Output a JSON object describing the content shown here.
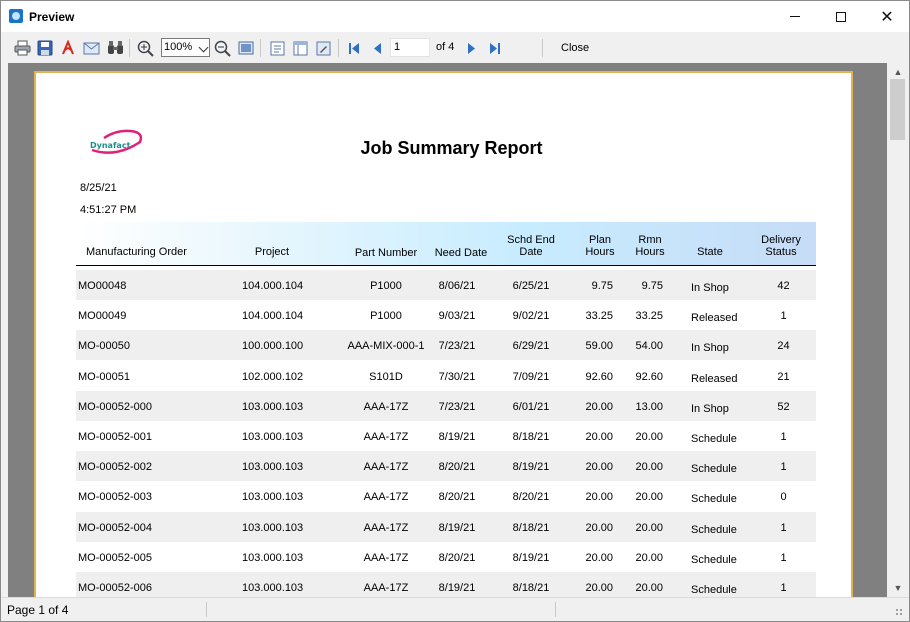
{
  "window": {
    "title": "Preview"
  },
  "toolbar": {
    "zoom": "100%",
    "page_number": "1",
    "page_of": "of 4",
    "close_label": "Close",
    "icons": [
      "print-icon",
      "save-icon",
      "pdf-icon",
      "email-icon",
      "find-icon",
      "zoom-in-icon",
      "zoom-out-icon",
      "fit-page-icon",
      "single-page-icon",
      "two-page-icon",
      "page-setup-icon",
      "first-page-icon",
      "previous-page-icon",
      "next-page-icon",
      "last-page-icon"
    ]
  },
  "report": {
    "logo_text": "Dynafact",
    "title": "Job Summary Report",
    "date": "8/25/21",
    "time": "4:51:27 PM",
    "columns": {
      "mo": "Manufacturing Order",
      "project": "Project",
      "part": "Part Number",
      "need": "Need Date",
      "sched_1": "Schd End",
      "sched_2": "Date",
      "plan_1": "Plan",
      "plan_2": "Hours",
      "rmn_1": "Rmn",
      "rmn_2": "Hours",
      "state": "State",
      "deliv_1": "Delivery",
      "deliv_2": "Status"
    },
    "rows": [
      {
        "mo": "MO00048",
        "project": "104.000.104",
        "part": "P1000",
        "need": "8/06/21",
        "sched": "6/25/21",
        "plan": "9.75",
        "rmn": "9.75",
        "state": "In Shop",
        "deliv": "42"
      },
      {
        "mo": "MO00049",
        "project": "104.000.104",
        "part": "P1000",
        "need": "9/03/21",
        "sched": "9/02/21",
        "plan": "33.25",
        "rmn": "33.25",
        "state": "Released",
        "deliv": "1"
      },
      {
        "mo": "MO-00050",
        "project": "100.000.100",
        "part": "AAA-MIX-000-1",
        "need": "7/23/21",
        "sched": "6/29/21",
        "plan": "59.00",
        "rmn": "54.00",
        "state": "In Shop",
        "deliv": "24"
      },
      {
        "mo": "MO-00051",
        "project": "102.000.102",
        "part": "S101D",
        "need": "7/30/21",
        "sched": "7/09/21",
        "plan": "92.60",
        "rmn": "92.60",
        "state": "Released",
        "deliv": "21"
      },
      {
        "mo": "MO-00052-000",
        "project": "103.000.103",
        "part": "AAA-17Z",
        "need": "7/23/21",
        "sched": "6/01/21",
        "plan": "20.00",
        "rmn": "13.00",
        "state": "In Shop",
        "deliv": "52"
      },
      {
        "mo": "MO-00052-001",
        "project": "103.000.103",
        "part": "AAA-17Z",
        "need": "8/19/21",
        "sched": "8/18/21",
        "plan": "20.00",
        "rmn": "20.00",
        "state": "Schedule",
        "deliv": "1"
      },
      {
        "mo": "MO-00052-002",
        "project": "103.000.103",
        "part": "AAA-17Z",
        "need": "8/20/21",
        "sched": "8/19/21",
        "plan": "20.00",
        "rmn": "20.00",
        "state": "Schedule",
        "deliv": "1"
      },
      {
        "mo": "MO-00052-003",
        "project": "103.000.103",
        "part": "AAA-17Z",
        "need": "8/20/21",
        "sched": "8/20/21",
        "plan": "20.00",
        "rmn": "20.00",
        "state": "Schedule",
        "deliv": "0"
      },
      {
        "mo": "MO-00052-004",
        "project": "103.000.103",
        "part": "AAA-17Z",
        "need": "8/19/21",
        "sched": "8/18/21",
        "plan": "20.00",
        "rmn": "20.00",
        "state": "Schedule",
        "deliv": "1"
      },
      {
        "mo": "MO-00052-005",
        "project": "103.000.103",
        "part": "AAA-17Z",
        "need": "8/20/21",
        "sched": "8/19/21",
        "plan": "20.00",
        "rmn": "20.00",
        "state": "Schedule",
        "deliv": "1"
      },
      {
        "mo": "MO-00052-006",
        "project": "103.000.103",
        "part": "AAA-17Z",
        "need": "8/19/21",
        "sched": "8/18/21",
        "plan": "20.00",
        "rmn": "20.00",
        "state": "Schedule",
        "deliv": "1"
      }
    ]
  },
  "status": {
    "page_text": "Page 1 of 4"
  },
  "colors": {
    "accent": "#1a73c9",
    "page_border": "#e0b452",
    "header_band": "#c8ecff",
    "row_shade": "#efefef",
    "logo": "#e0207a"
  }
}
